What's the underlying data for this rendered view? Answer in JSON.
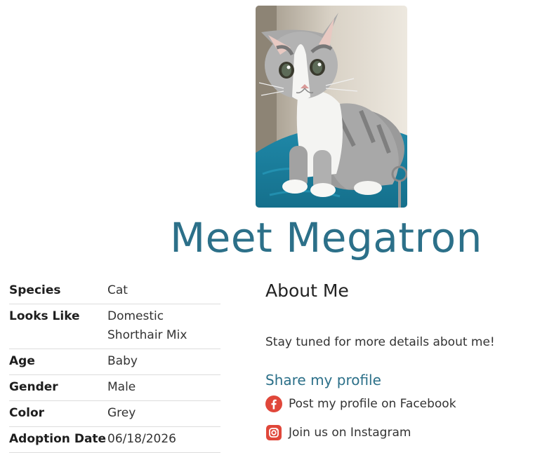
{
  "profile": {
    "image_alt": "Megatron",
    "title": "Meet Megatron"
  },
  "details": [
    {
      "label": "Species",
      "value": "Cat"
    },
    {
      "label": "Looks Like",
      "value": "Domestic Shorthair Mix"
    },
    {
      "label": "Age",
      "value": "Baby"
    },
    {
      "label": "Gender",
      "value": "Male"
    },
    {
      "label": "Color",
      "value": "Grey"
    },
    {
      "label": "Adoption Date",
      "value": "06/18/2026"
    }
  ],
  "about": {
    "heading": "About Me",
    "description": "Stay tuned for more details about me!"
  },
  "share": {
    "heading": "Share my profile",
    "facebook_label": "Post my profile on Facebook",
    "instagram_label": "Join us on Instagram"
  },
  "colors": {
    "accent": "#2c7089",
    "social_red": "#e0473a"
  },
  "icons": {
    "facebook": "facebook-icon",
    "instagram": "instagram-icon"
  }
}
